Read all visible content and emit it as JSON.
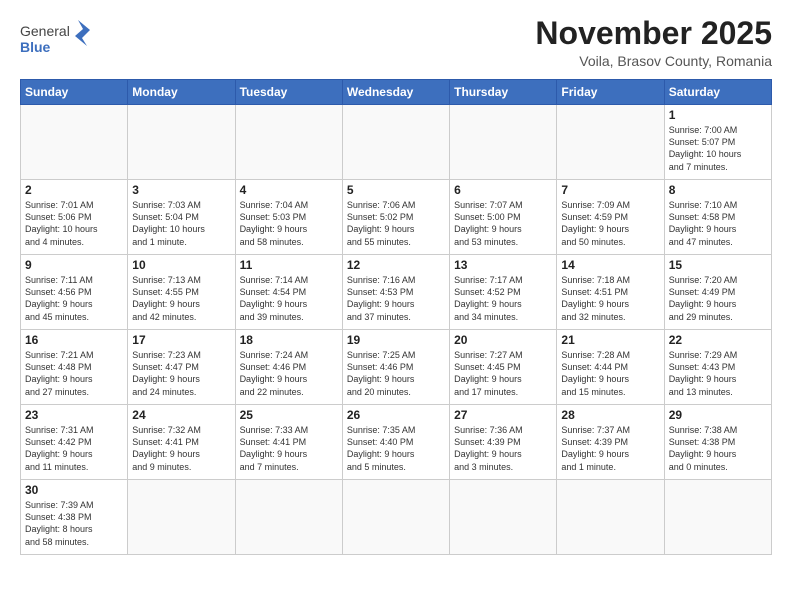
{
  "header": {
    "logo_general": "General",
    "logo_blue": "Blue",
    "month_title": "November 2025",
    "subtitle": "Voila, Brasov County, Romania"
  },
  "weekdays": [
    "Sunday",
    "Monday",
    "Tuesday",
    "Wednesday",
    "Thursday",
    "Friday",
    "Saturday"
  ],
  "weeks": [
    [
      {
        "day": "",
        "info": ""
      },
      {
        "day": "",
        "info": ""
      },
      {
        "day": "",
        "info": ""
      },
      {
        "day": "",
        "info": ""
      },
      {
        "day": "",
        "info": ""
      },
      {
        "day": "",
        "info": ""
      },
      {
        "day": "1",
        "info": "Sunrise: 7:00 AM\nSunset: 5:07 PM\nDaylight: 10 hours\nand 7 minutes."
      }
    ],
    [
      {
        "day": "2",
        "info": "Sunrise: 7:01 AM\nSunset: 5:06 PM\nDaylight: 10 hours\nand 4 minutes."
      },
      {
        "day": "3",
        "info": "Sunrise: 7:03 AM\nSunset: 5:04 PM\nDaylight: 10 hours\nand 1 minute."
      },
      {
        "day": "4",
        "info": "Sunrise: 7:04 AM\nSunset: 5:03 PM\nDaylight: 9 hours\nand 58 minutes."
      },
      {
        "day": "5",
        "info": "Sunrise: 7:06 AM\nSunset: 5:02 PM\nDaylight: 9 hours\nand 55 minutes."
      },
      {
        "day": "6",
        "info": "Sunrise: 7:07 AM\nSunset: 5:00 PM\nDaylight: 9 hours\nand 53 minutes."
      },
      {
        "day": "7",
        "info": "Sunrise: 7:09 AM\nSunset: 4:59 PM\nDaylight: 9 hours\nand 50 minutes."
      },
      {
        "day": "8",
        "info": "Sunrise: 7:10 AM\nSunset: 4:58 PM\nDaylight: 9 hours\nand 47 minutes."
      }
    ],
    [
      {
        "day": "9",
        "info": "Sunrise: 7:11 AM\nSunset: 4:56 PM\nDaylight: 9 hours\nand 45 minutes."
      },
      {
        "day": "10",
        "info": "Sunrise: 7:13 AM\nSunset: 4:55 PM\nDaylight: 9 hours\nand 42 minutes."
      },
      {
        "day": "11",
        "info": "Sunrise: 7:14 AM\nSunset: 4:54 PM\nDaylight: 9 hours\nand 39 minutes."
      },
      {
        "day": "12",
        "info": "Sunrise: 7:16 AM\nSunset: 4:53 PM\nDaylight: 9 hours\nand 37 minutes."
      },
      {
        "day": "13",
        "info": "Sunrise: 7:17 AM\nSunset: 4:52 PM\nDaylight: 9 hours\nand 34 minutes."
      },
      {
        "day": "14",
        "info": "Sunrise: 7:18 AM\nSunset: 4:51 PM\nDaylight: 9 hours\nand 32 minutes."
      },
      {
        "day": "15",
        "info": "Sunrise: 7:20 AM\nSunset: 4:49 PM\nDaylight: 9 hours\nand 29 minutes."
      }
    ],
    [
      {
        "day": "16",
        "info": "Sunrise: 7:21 AM\nSunset: 4:48 PM\nDaylight: 9 hours\nand 27 minutes."
      },
      {
        "day": "17",
        "info": "Sunrise: 7:23 AM\nSunset: 4:47 PM\nDaylight: 9 hours\nand 24 minutes."
      },
      {
        "day": "18",
        "info": "Sunrise: 7:24 AM\nSunset: 4:46 PM\nDaylight: 9 hours\nand 22 minutes."
      },
      {
        "day": "19",
        "info": "Sunrise: 7:25 AM\nSunset: 4:46 PM\nDaylight: 9 hours\nand 20 minutes."
      },
      {
        "day": "20",
        "info": "Sunrise: 7:27 AM\nSunset: 4:45 PM\nDaylight: 9 hours\nand 17 minutes."
      },
      {
        "day": "21",
        "info": "Sunrise: 7:28 AM\nSunset: 4:44 PM\nDaylight: 9 hours\nand 15 minutes."
      },
      {
        "day": "22",
        "info": "Sunrise: 7:29 AM\nSunset: 4:43 PM\nDaylight: 9 hours\nand 13 minutes."
      }
    ],
    [
      {
        "day": "23",
        "info": "Sunrise: 7:31 AM\nSunset: 4:42 PM\nDaylight: 9 hours\nand 11 minutes."
      },
      {
        "day": "24",
        "info": "Sunrise: 7:32 AM\nSunset: 4:41 PM\nDaylight: 9 hours\nand 9 minutes."
      },
      {
        "day": "25",
        "info": "Sunrise: 7:33 AM\nSunset: 4:41 PM\nDaylight: 9 hours\nand 7 minutes."
      },
      {
        "day": "26",
        "info": "Sunrise: 7:35 AM\nSunset: 4:40 PM\nDaylight: 9 hours\nand 5 minutes."
      },
      {
        "day": "27",
        "info": "Sunrise: 7:36 AM\nSunset: 4:39 PM\nDaylight: 9 hours\nand 3 minutes."
      },
      {
        "day": "28",
        "info": "Sunrise: 7:37 AM\nSunset: 4:39 PM\nDaylight: 9 hours\nand 1 minute."
      },
      {
        "day": "29",
        "info": "Sunrise: 7:38 AM\nSunset: 4:38 PM\nDaylight: 9 hours\nand 0 minutes."
      }
    ],
    [
      {
        "day": "30",
        "info": "Sunrise: 7:39 AM\nSunset: 4:38 PM\nDaylight: 8 hours\nand 58 minutes."
      },
      {
        "day": "",
        "info": ""
      },
      {
        "day": "",
        "info": ""
      },
      {
        "day": "",
        "info": ""
      },
      {
        "day": "",
        "info": ""
      },
      {
        "day": "",
        "info": ""
      },
      {
        "day": "",
        "info": ""
      }
    ]
  ]
}
